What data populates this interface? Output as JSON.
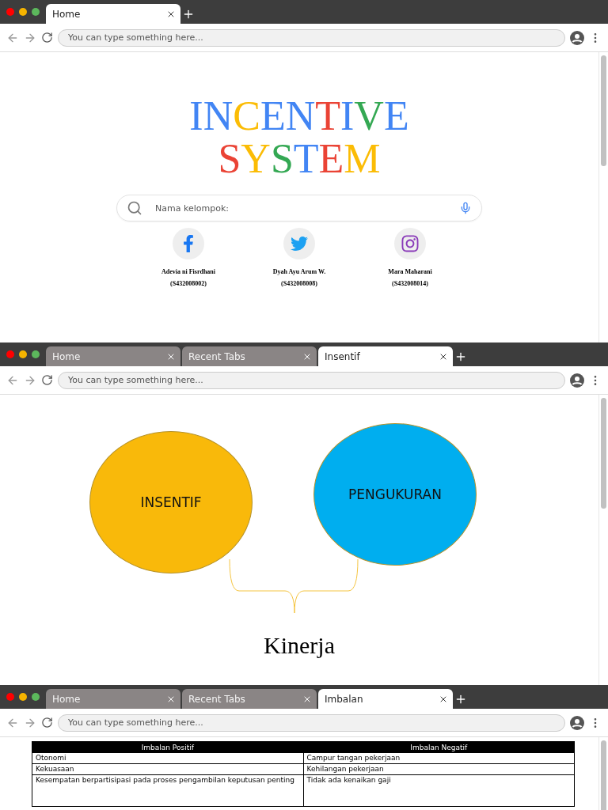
{
  "windows": [
    {
      "kind": "title",
      "tabs": [
        {
          "label": "Home",
          "selected": true
        }
      ],
      "address": {
        "placeholder": "You can type something here..."
      },
      "title_lines": [
        [
          {
            "text": "I",
            "color": "#4285f4"
          },
          {
            "text": "N",
            "color": "#4285f4"
          },
          {
            "text": "C",
            "color": "#fbbc05"
          },
          {
            "text": "E",
            "color": "#4285f4"
          },
          {
            "text": "N",
            "color": "#4285f4"
          },
          {
            "text": "T",
            "color": "#ea4335"
          },
          {
            "text": "I",
            "color": "#4285f4"
          },
          {
            "text": "V",
            "color": "#34a853"
          },
          {
            "text": "E",
            "color": "#4285f4"
          }
        ],
        [
          {
            "text": "S",
            "color": "#ea4335"
          },
          {
            "text": "Y",
            "color": "#fbbc05"
          },
          {
            "text": "S",
            "color": "#34a853"
          },
          {
            "text": "T",
            "color": "#4285f4"
          },
          {
            "text": "E",
            "color": "#ea4335"
          },
          {
            "text": "M",
            "color": "#fbbc05"
          }
        ]
      ],
      "search": {
        "placeholder": "Nama kelompok:"
      },
      "members": [
        {
          "kind": "f",
          "name": "Adevia ni Fisrdhani",
          "id": "(S432008002)"
        },
        {
          "kind": "bird",
          "name": "Dyah Ayu Arum W.",
          "id": "(S432008008)"
        },
        {
          "kind": "camera",
          "name": "Mara Maharani",
          "id": "(S432008014)"
        }
      ]
    },
    {
      "kind": "diagram",
      "tabs": [
        {
          "label": "Home",
          "selected": false
        },
        {
          "label": "Recent Tabs",
          "selected": false
        },
        {
          "label": "Insentif",
          "selected": true
        }
      ],
      "address": {
        "placeholder": "You can type something here..."
      },
      "nodes": [
        {
          "label": "INSENTIF",
          "color": "#f9b90a"
        },
        {
          "label": "PENGUKURAN",
          "color": "#00aeef"
        }
      ],
      "result": "Kinerja"
    },
    {
      "kind": "table",
      "tabs": [
        {
          "label": "Home",
          "selected": false
        },
        {
          "label": "Recent Tabs",
          "selected": false
        },
        {
          "label": "Imbalan",
          "selected": true
        }
      ],
      "address": {
        "placeholder": "You can type something here..."
      },
      "table": {
        "columns": [
          "Imbalan Positif",
          "Imbalan Negatif"
        ],
        "rows": [
          [
            "Otonomi",
            "Campur tangan pekerjaan"
          ],
          [
            "Kekuasaan",
            "Kehilangan pekerjaan"
          ],
          [
            "Kesempatan berpartisipasi pada proses pengambilan keputusan penting",
            "Tidak ada kenaikan gaji"
          ]
        ]
      }
    }
  ]
}
